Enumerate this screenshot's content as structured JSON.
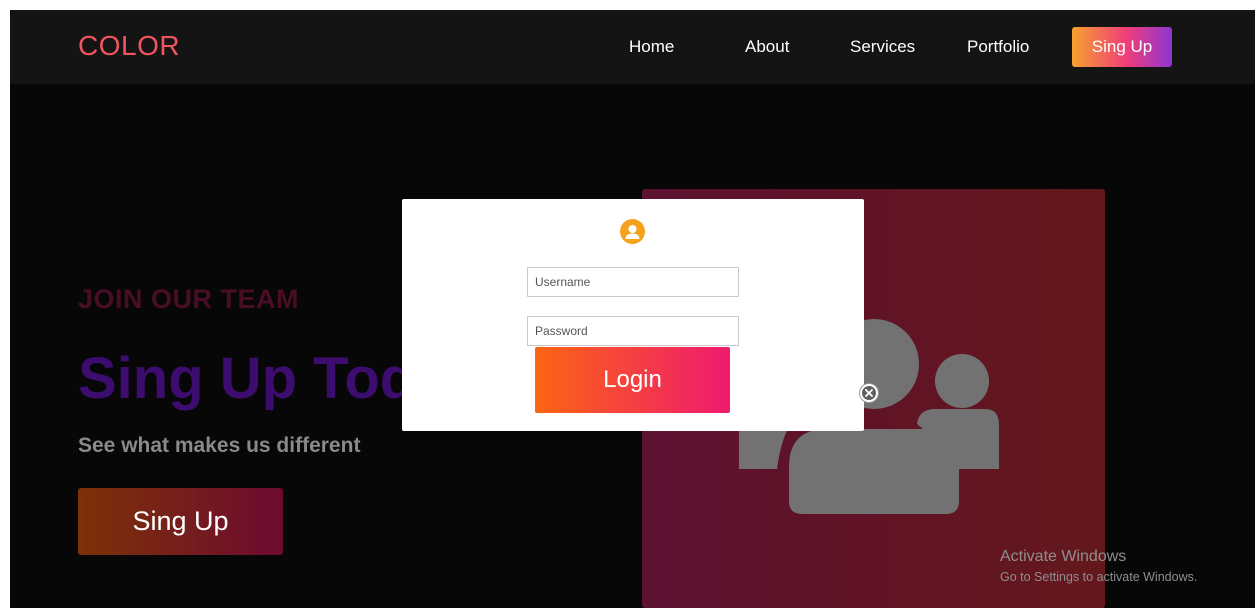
{
  "header": {
    "logo": "COLOR",
    "nav": [
      "Home",
      "About",
      "Services",
      "Portfolio"
    ],
    "cta_label": "Sing Up"
  },
  "hero": {
    "eyebrow": "JOIN OUR TEAM",
    "title": "Sing Up Today",
    "subtitle": "See what makes us different",
    "button_label": "Sing Up",
    "image_icon": "team-icon"
  },
  "modal": {
    "avatar_icon": "user-icon",
    "close_icon": "close-icon",
    "username_placeholder": "Username",
    "password_placeholder": "Password",
    "login_label": "Login"
  },
  "watermark": {
    "title": "Activate Windows",
    "subtitle": "Go to Settings to activate Windows."
  },
  "colors": {
    "logo": "#f0555f",
    "eyebrow": "#4a0d26",
    "title": "#3c0d6e",
    "login_gradient": [
      "#fb6513",
      "#ef1a6e"
    ],
    "cta_gradient": [
      "#f7a12e",
      "#ef3d7a",
      "#8e36d1"
    ],
    "avatar": "#f3a21d"
  }
}
